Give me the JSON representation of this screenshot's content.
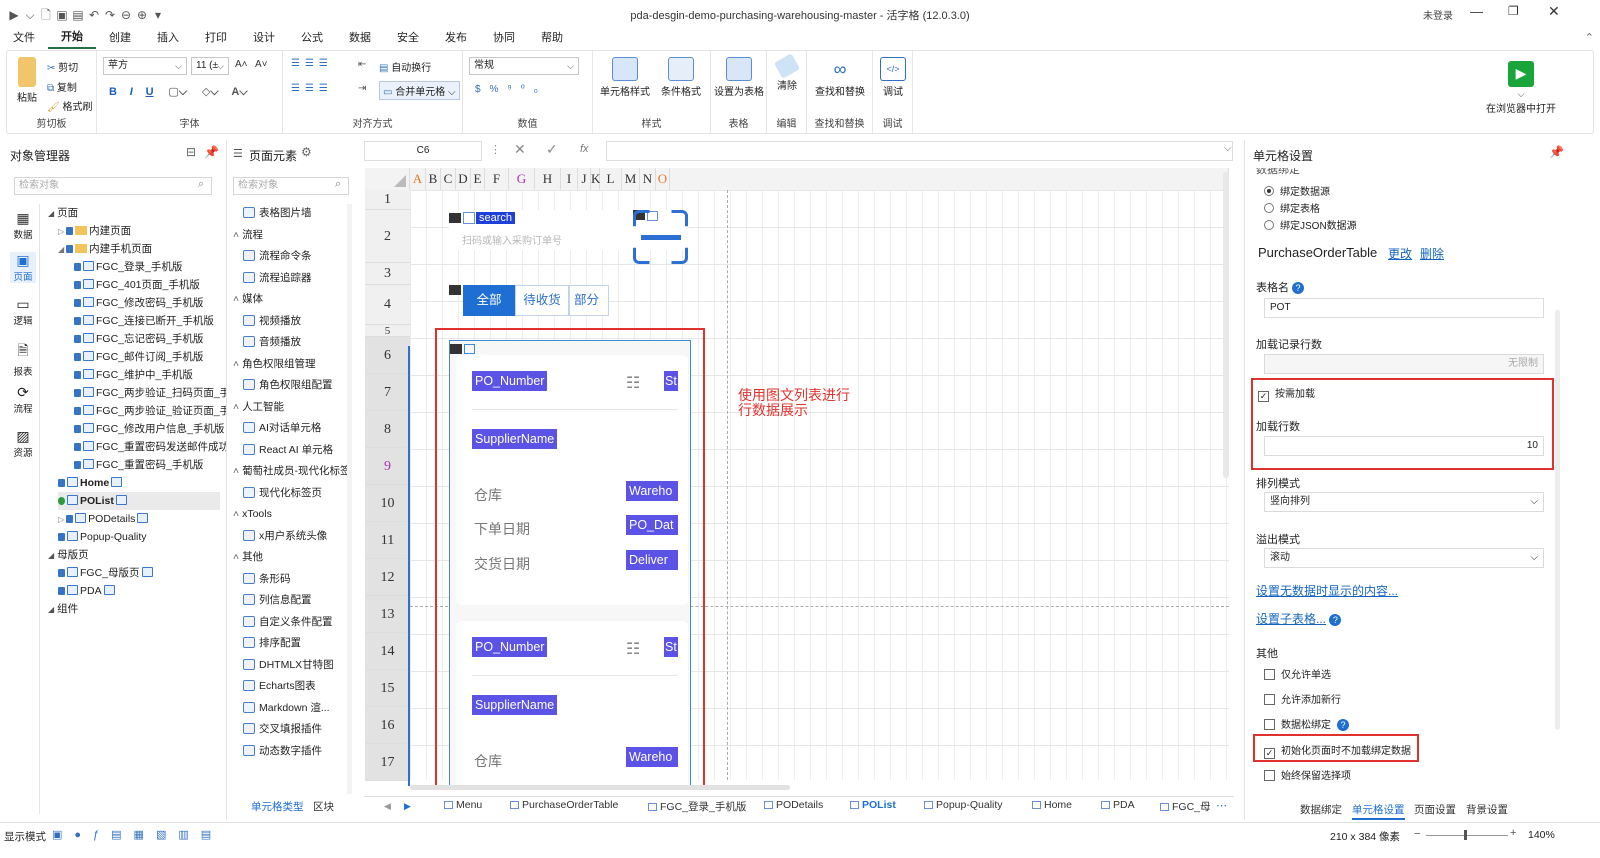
{
  "window": {
    "title": "pda-desgin-demo-purchasing-warehousing-master - 活字格 (12.0.3.0)",
    "login": "未登录"
  },
  "menu": [
    "文件",
    "开始",
    "创建",
    "插入",
    "打印",
    "设计",
    "公式",
    "数据",
    "安全",
    "发布",
    "协同",
    "帮助"
  ],
  "ribbon": {
    "clipboard": {
      "paste": "粘贴",
      "cut": "剪切",
      "copy": "复制",
      "format_painter": "格式刷",
      "label": "剪切板"
    },
    "font": {
      "family": "苹方",
      "size": "11 (±",
      "label": "字体"
    },
    "align": {
      "wrap": "自动换行",
      "merge": "合并单元格",
      "label": "对齐方式"
    },
    "number": {
      "format": "常规",
      "label": "数值"
    },
    "style": {
      "cell_style": "单元格样式",
      "cond_format": "条件格式",
      "label": "样式"
    },
    "table": {
      "set_table": "设置为表格",
      "label": "表格"
    },
    "edit": {
      "clear": "清除",
      "label": "编辑"
    },
    "find": {
      "find_replace": "查找和替换",
      "label": "查找和替换"
    },
    "debug": {
      "debug": "调试",
      "label": "调试"
    },
    "open_browser": "在浏览器中打开"
  },
  "object_manager": {
    "title": "对象管理器",
    "search_placeholder": "检索对象",
    "side_icons": [
      "数据",
      "页面",
      "逻辑",
      "报表",
      "流程",
      "资源"
    ],
    "tree": [
      {
        "label": "页面",
        "level": 0
      },
      {
        "label": "内建页面",
        "level": 1
      },
      {
        "label": "内建手机页面",
        "level": 1
      },
      {
        "label": "FGC_登录_手机版",
        "level": 2
      },
      {
        "label": "FGC_401页面_手机版",
        "level": 2
      },
      {
        "label": "FGC_修改密码_手机版",
        "level": 2
      },
      {
        "label": "FGC_连接已断开_手机版",
        "level": 2
      },
      {
        "label": "FGC_忘记密码_手机版",
        "level": 2
      },
      {
        "label": "FGC_邮件订阅_手机版",
        "level": 2
      },
      {
        "label": "FGC_维护中_手机版",
        "level": 2
      },
      {
        "label": "FGC_两步验证_扫码页面_手",
        "level": 2
      },
      {
        "label": "FGC_两步验证_验证页面_手",
        "level": 2
      },
      {
        "label": "FGC_修改用户信息_手机版",
        "level": 2
      },
      {
        "label": "FGC_重置密码发送邮件成功",
        "level": 2
      },
      {
        "label": "FGC_重置密码_手机版",
        "level": 2
      },
      {
        "label": "Home",
        "level": 1
      },
      {
        "label": "POList",
        "level": 1
      },
      {
        "label": "PODetails",
        "level": 1
      },
      {
        "label": "Popup-Quality",
        "level": 1
      },
      {
        "label": "母版页",
        "level": 0
      },
      {
        "label": "FGC_母版页",
        "level": 1
      },
      {
        "label": "PDA",
        "level": 1
      },
      {
        "label": "组件",
        "level": 0
      }
    ]
  },
  "page_elements": {
    "title": "页面元素",
    "search_placeholder": "检索对象",
    "items": [
      {
        "type": "item",
        "label": "表格图片墙"
      },
      {
        "type": "cat",
        "label": "流程"
      },
      {
        "type": "item",
        "label": "流程命令条"
      },
      {
        "type": "item",
        "label": "流程追踪器"
      },
      {
        "type": "cat",
        "label": "媒体"
      },
      {
        "type": "item",
        "label": "视频播放"
      },
      {
        "type": "item",
        "label": "音频播放"
      },
      {
        "type": "cat",
        "label": "角色权限组管理"
      },
      {
        "type": "item",
        "label": "角色权限组配置"
      },
      {
        "type": "cat",
        "label": "人工智能"
      },
      {
        "type": "item",
        "label": "AI对话单元格"
      },
      {
        "type": "item",
        "label": "React AI 单元格"
      },
      {
        "type": "cat",
        "label": "葡萄社成员-现代化标签"
      },
      {
        "type": "item",
        "label": "现代化标签页"
      },
      {
        "type": "cat",
        "label": "xTools"
      },
      {
        "type": "item",
        "label": "x用户系统头像"
      },
      {
        "type": "cat",
        "label": "其他"
      },
      {
        "type": "item",
        "label": "条形码"
      },
      {
        "type": "item",
        "label": "列信息配置"
      },
      {
        "type": "item",
        "label": "自定义条件配置"
      },
      {
        "type": "item",
        "label": "排序配置"
      },
      {
        "type": "item",
        "label": "DHTMLX甘特图"
      },
      {
        "type": "item",
        "label": "Echarts图表"
      },
      {
        "type": "item",
        "label": "Markdown 渲..."
      },
      {
        "type": "item",
        "label": "交叉填报插件"
      },
      {
        "type": "item",
        "label": "动态数字插件"
      }
    ],
    "bottom_tabs": [
      "单元格类型",
      "区块"
    ]
  },
  "formula_bar": {
    "cell_ref": "C6",
    "fx": "fx"
  },
  "sheet": {
    "columns": [
      "A",
      "B",
      "C",
      "D",
      "E",
      "F",
      "G",
      "H",
      "I",
      "J",
      "K",
      "L",
      "M",
      "N",
      "O"
    ],
    "rows": [
      "1",
      "2",
      "3",
      "4",
      "5",
      "6",
      "7",
      "8",
      "9",
      "10",
      "11",
      "12",
      "13",
      "14",
      "15",
      "16",
      "17"
    ],
    "search_label": "search",
    "search_placeholder": "扫码或输入采购订单号",
    "tabs": [
      "全部",
      "待收货",
      "部分收"
    ],
    "card1": {
      "po": "PO_Number",
      "st": "St",
      "supplier": "SupplierName",
      "lbl_wh": "仓库",
      "lbl_date": "下单日期",
      "lbl_delivery": "交货日期",
      "wh": "Wareho",
      "date": "PO_Dat",
      "delivery": "Deliver"
    },
    "card2": {
      "po": "PO_Number",
      "st": "St",
      "supplier": "SupplierName",
      "lbl_wh": "仓库",
      "wh": "Wareho"
    },
    "annotation": "使用图文列表进行\n行数据展示"
  },
  "sheet_tabs": [
    "Menu",
    "PurchaseOrderTable",
    "FGC_登录_手机版",
    "PODetails",
    "POList",
    "Popup-Quality",
    "Home",
    "PDA",
    "FGC_母"
  ],
  "active_sheet_tab": "POList",
  "cell_settings": {
    "title": "单元格设置",
    "data_bind_header": "数据绑定",
    "bind_options": [
      "绑定数据源",
      "绑定表格",
      "绑定JSON数据源"
    ],
    "table_name_value": "PurchaseOrderTable",
    "change": "更改",
    "delete": "删除",
    "table_alias_label": "表格名",
    "table_alias_value": "POT",
    "load_rows_label": "加载记录行数",
    "load_rows_value": "无限制",
    "on_demand": "按需加载",
    "load_count_label": "加载行数",
    "load_count_value": "10",
    "arrange_label": "排列模式",
    "arrange_value": "竖向排列",
    "overflow_label": "溢出模式",
    "overflow_value": "滚动",
    "no_data_link": "设置无数据时显示的内容...",
    "sub_table_link": "设置子表格...",
    "other_label": "其他",
    "options": [
      {
        "label": "仅允许单选",
        "checked": false
      },
      {
        "label": "允许添加新行",
        "checked": false
      },
      {
        "label": "数据松绑定",
        "checked": false
      },
      {
        "label": "初始化页面时不加载绑定数据",
        "checked": true
      },
      {
        "label": "始终保留选择项",
        "checked": false
      }
    ],
    "bottom_tabs": [
      "数据绑定",
      "单元格设置",
      "页面设置",
      "背景设置"
    ]
  },
  "status": {
    "mode": "显示模式",
    "size": "210 x 384 像素",
    "zoom": "140%"
  }
}
